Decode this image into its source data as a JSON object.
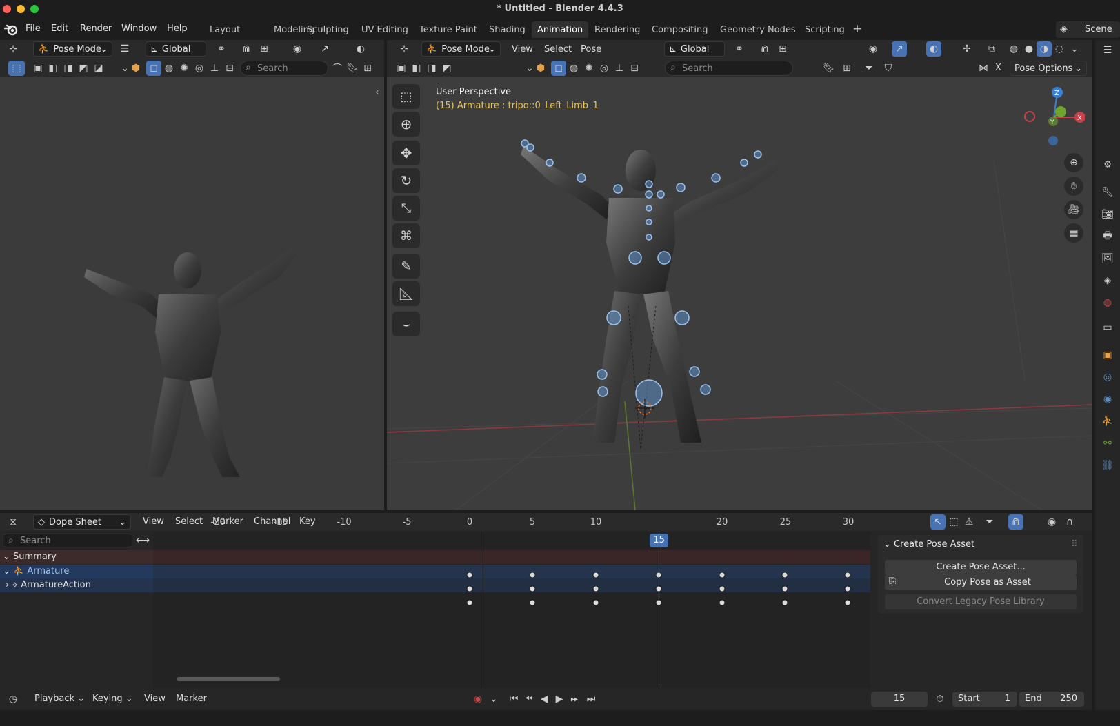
{
  "window": {
    "title": "* Untitled - Blender 4.4.3"
  },
  "menubar": {
    "items": [
      "File",
      "Edit",
      "Render",
      "Window",
      "Help"
    ],
    "workspaces": [
      "Layout",
      "Modeling",
      "Sculpting",
      "UV Editing",
      "Texture Paint",
      "Shading",
      "Animation",
      "Rendering",
      "Compositing",
      "Geometry Nodes",
      "Scripting"
    ],
    "active_workspace": "Animation",
    "add_tab": "+",
    "scene_label": "Scene"
  },
  "left_viewport": {
    "mode": "Pose Mode",
    "orientation": "Global",
    "search_placeholder": "Search"
  },
  "right_viewport": {
    "mode": "Pose Mode",
    "menus": [
      "View",
      "Select",
      "Pose"
    ],
    "orientation": "Global",
    "search_placeholder": "Search",
    "pose_options": "Pose Options",
    "x_label": "X",
    "overlay_title": "User Perspective",
    "overlay_info": "(15) Armature : tripo::0_Left_Limb_1",
    "gizmo": {
      "x": "X",
      "y": "Y",
      "z": "Z"
    }
  },
  "dope_sheet": {
    "mode": "Dope Sheet",
    "menus": [
      "View",
      "Select",
      "Marker",
      "Channel",
      "Key"
    ],
    "search_placeholder": "Search",
    "channels": [
      "Summary",
      "Armature",
      "ArmatureAction"
    ],
    "frame_ticks": [
      "-20",
      "-15",
      "-10",
      "-5",
      "0",
      "5",
      "10",
      "15",
      "20",
      "25",
      "30"
    ],
    "current_frame": "15",
    "keyframes": [
      0,
      5,
      10,
      15,
      20,
      25,
      30
    ]
  },
  "pose_asset_panel": {
    "title": "Create Pose Asset",
    "buttons": [
      "Create Pose Asset...",
      "Copy Pose as Asset",
      "Convert Legacy Pose Library"
    ]
  },
  "timeline": {
    "menus": [
      "Playback",
      "Keying",
      "View",
      "Marker"
    ],
    "current_frame": "15",
    "start_label": "Start",
    "start_value": "1",
    "end_label": "End",
    "end_value": "250"
  },
  "colors": {
    "accent": "#4772b3",
    "overlay_info": "#e8c65a",
    "bone_fill": "#5f8ec6",
    "x_axis": "#c8404a",
    "y_axis": "#6ea52e",
    "z_axis": "#3b80d6"
  }
}
